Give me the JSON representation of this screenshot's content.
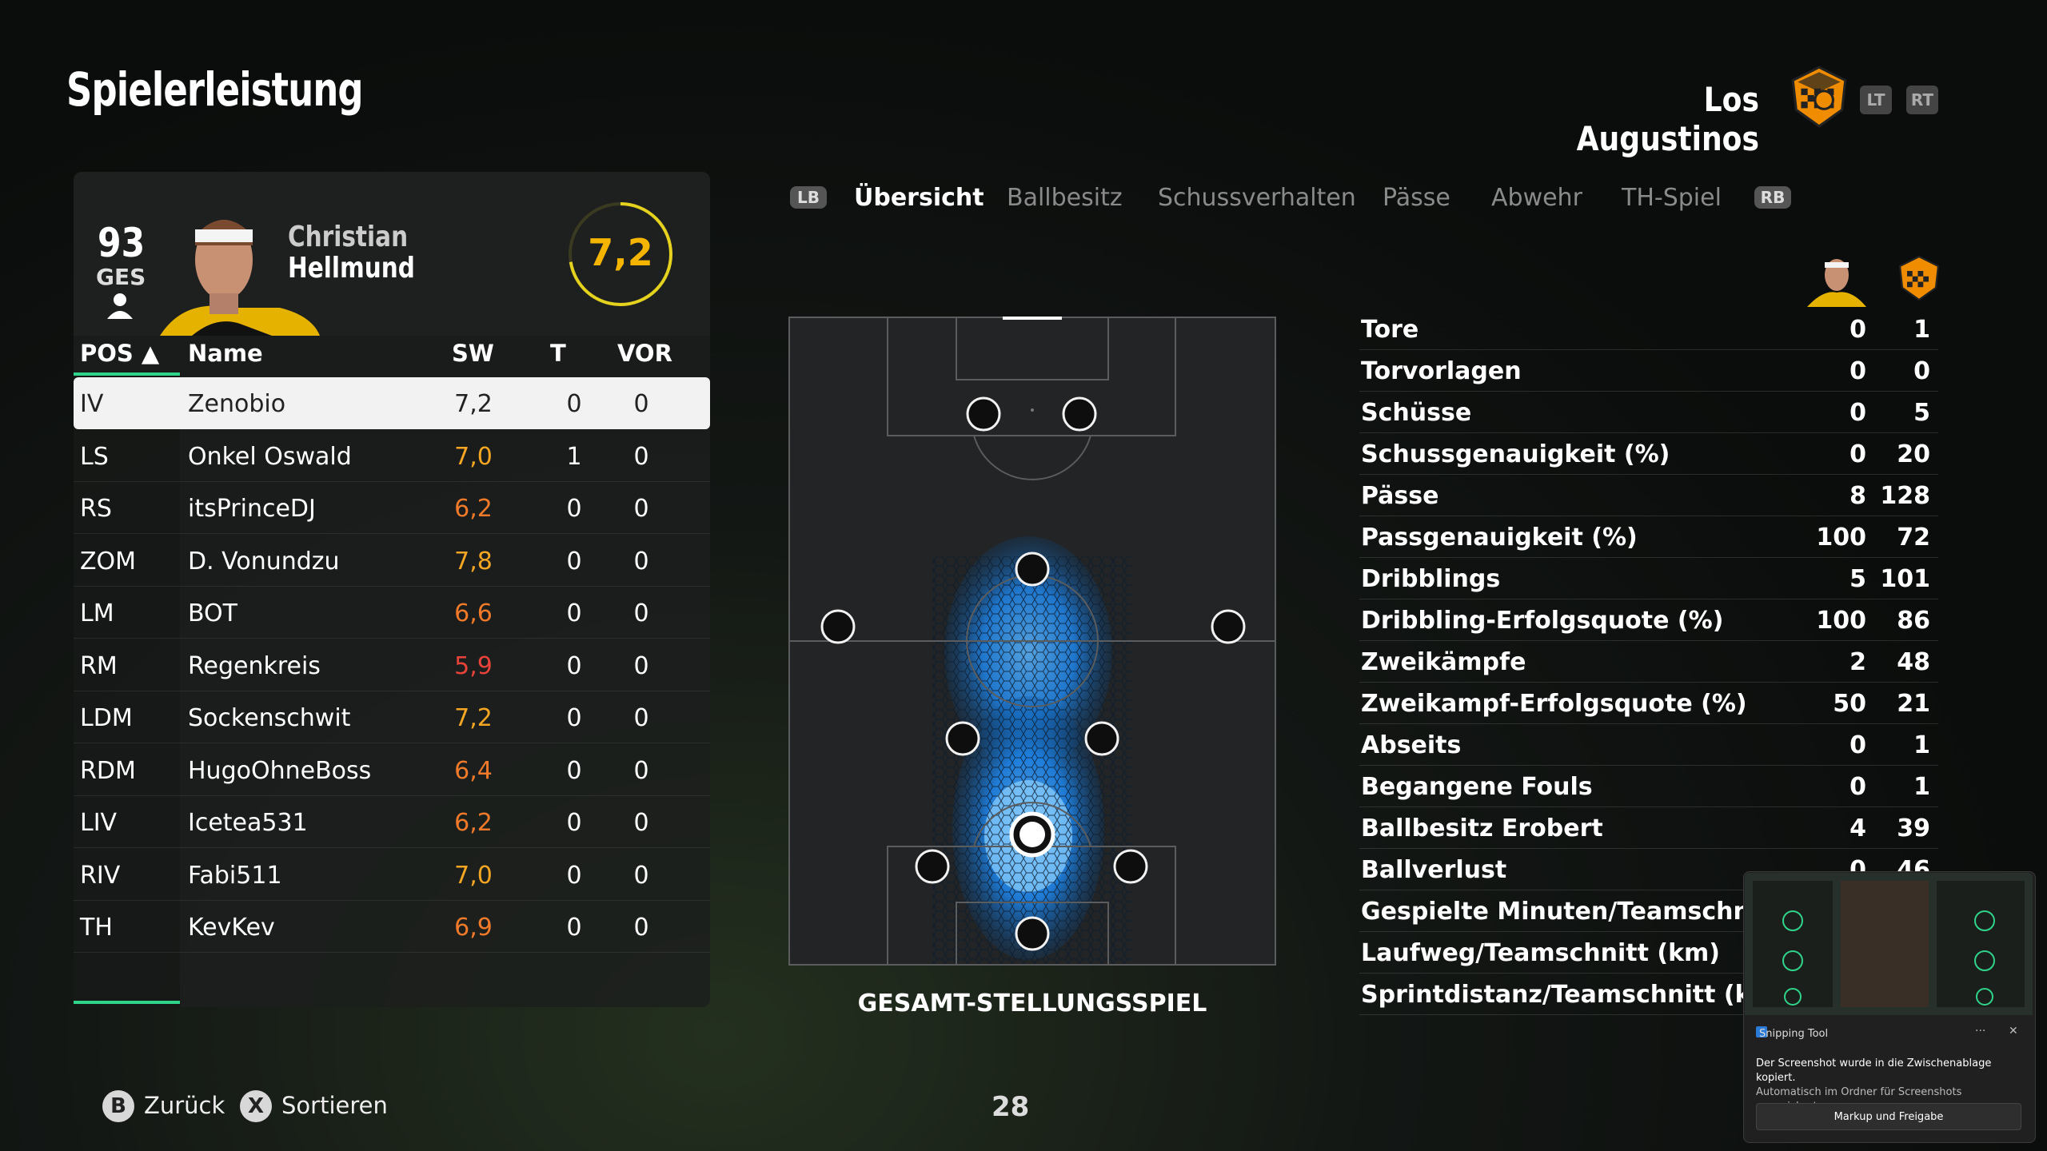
{
  "header": {
    "title": "Spielerleistung",
    "team": "Los Augustinos",
    "trigger_left": "LT",
    "trigger_right": "RT"
  },
  "player": {
    "overall": "93",
    "overall_label": "GES",
    "first_name": "Christian",
    "last_name": "Hellmund",
    "rating": "7,2"
  },
  "table": {
    "headers": {
      "pos": "POS ▲",
      "name": "Name",
      "sw": "SW",
      "t": "T",
      "vor": "VOR"
    },
    "rows": [
      {
        "pos": "IV",
        "name": "Zenobio",
        "sw": "7,2",
        "t": "0",
        "vor": "0",
        "color": "#222222"
      },
      {
        "pos": "LS",
        "name": "Onkel Oswald",
        "sw": "7,0",
        "t": "1",
        "vor": "0",
        "color": "#f5a623"
      },
      {
        "pos": "RS",
        "name": "itsPrinceDJ",
        "sw": "6,2",
        "t": "0",
        "vor": "0",
        "color": "#f07a2a"
      },
      {
        "pos": "ZOM",
        "name": "D. Vonundzu",
        "sw": "7,8",
        "t": "0",
        "vor": "0",
        "color": "#f5a623"
      },
      {
        "pos": "LM",
        "name": "BOT",
        "sw": "6,6",
        "t": "0",
        "vor": "0",
        "color": "#f07a2a"
      },
      {
        "pos": "RM",
        "name": "Regenkreis",
        "sw": "5,9",
        "t": "0",
        "vor": "0",
        "color": "#e8433a"
      },
      {
        "pos": "LDM",
        "name": "Sockenschwit",
        "sw": "7,2",
        "t": "0",
        "vor": "0",
        "color": "#f5a623"
      },
      {
        "pos": "RDM",
        "name": "HugoOhneBoss",
        "sw": "6,4",
        "t": "0",
        "vor": "0",
        "color": "#f07a2a"
      },
      {
        "pos": "LIV",
        "name": "Icetea531",
        "sw": "6,2",
        "t": "0",
        "vor": "0",
        "color": "#f07a2a"
      },
      {
        "pos": "RIV",
        "name": "Fabi511",
        "sw": "7,0",
        "t": "0",
        "vor": "0",
        "color": "#f5a623"
      },
      {
        "pos": "TH",
        "name": "KevKev",
        "sw": "6,9",
        "t": "0",
        "vor": "0",
        "color": "#f07a2a"
      }
    ]
  },
  "tabs": {
    "lb": "LB",
    "rb": "RB",
    "items": [
      "Übersicht",
      "Ballbesitz",
      "Schussverhalten",
      "Pässe",
      "Abwehr",
      "TH-Spiel"
    ],
    "active": 0
  },
  "pitch": {
    "label": "GESAMT-STELLUNGSSPIEL"
  },
  "stats": [
    {
      "label": "Tore",
      "player": "0",
      "team": "1"
    },
    {
      "label": "Torvorlagen",
      "player": "0",
      "team": "0"
    },
    {
      "label": "Schüsse",
      "player": "0",
      "team": "5"
    },
    {
      "label": "Schussgenauigkeit (%)",
      "player": "0",
      "team": "20"
    },
    {
      "label": "Pässe",
      "player": "8",
      "team": "128"
    },
    {
      "label": "Passgenauigkeit (%)",
      "player": "100",
      "team": "72"
    },
    {
      "label": "Dribblings",
      "player": "5",
      "team": "101"
    },
    {
      "label": "Dribbling-Erfolgsquote (%)",
      "player": "100",
      "team": "86"
    },
    {
      "label": "Zweikämpfe",
      "player": "2",
      "team": "48"
    },
    {
      "label": "Zweikampf-Erfolgsquote (%)",
      "player": "50",
      "team": "21"
    },
    {
      "label": "Abseits",
      "player": "0",
      "team": "1"
    },
    {
      "label": "Begangene Fouls",
      "player": "0",
      "team": "1"
    },
    {
      "label": "Ballbesitz Erobert",
      "player": "4",
      "team": "39"
    },
    {
      "label": "Ballverlust",
      "player": "0",
      "team": "46"
    },
    {
      "label": "Gespielte Minuten/Teamschnitt",
      "player": "",
      "team": ""
    },
    {
      "label": "Laufweg/Teamschnitt (km)",
      "player": "",
      "team": ""
    },
    {
      "label": "Sprintdistanz/Teamschnitt (km)",
      "player": "",
      "team": ""
    }
  ],
  "footer": {
    "back_key": "B",
    "back_label": "Zurück",
    "sort_key": "X",
    "sort_label": "Sortieren",
    "page": "28"
  },
  "toast": {
    "app": "Snipping Tool",
    "message": "Der Screenshot wurde in die Zwischenablage kopiert.",
    "sub": "Automatisch im Ordner für Screenshots gespeichert.",
    "button": "Markup und Freigabe"
  },
  "colors": {
    "accent_green": "#2fd38a",
    "rating_ring": "#e4d21e",
    "rating_text": "#f5b400",
    "heat": "#1e8fff"
  }
}
